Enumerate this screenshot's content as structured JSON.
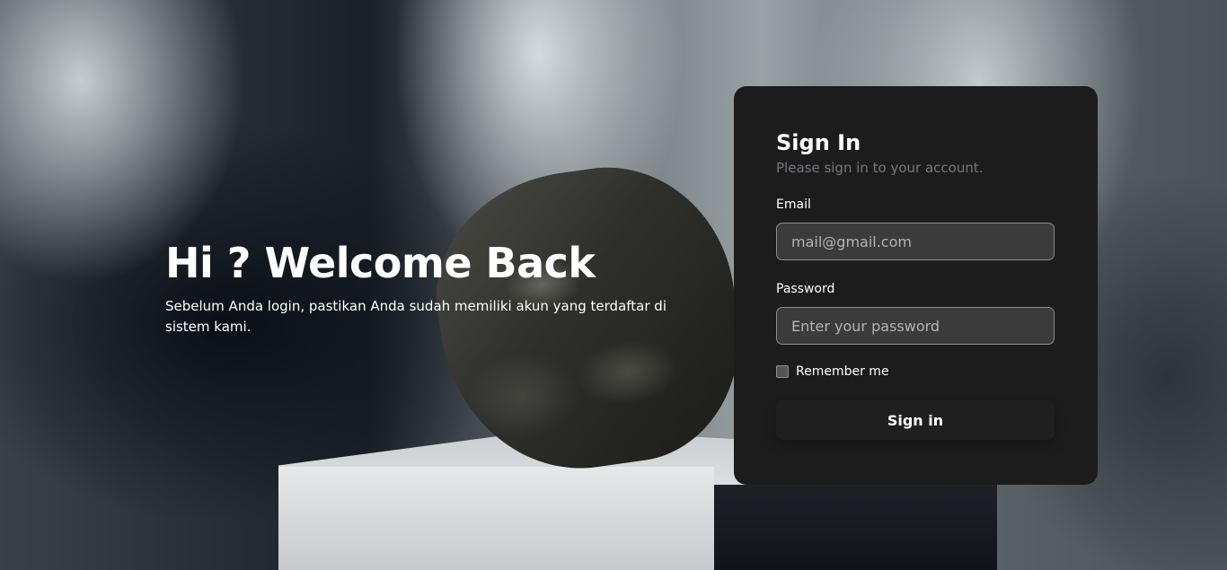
{
  "welcome": {
    "title": "Hi ? Welcome Back",
    "description": "Sebelum Anda login, pastikan Anda sudah memiliki akun yang terdaftar di sistem kami."
  },
  "signin": {
    "title": "Sign In",
    "subtitle": "Please sign in to your account.",
    "email_label": "Email",
    "email_placeholder": "mail@gmail.com",
    "email_value": "",
    "password_label": "Password",
    "password_placeholder": "Enter your password",
    "password_value": "",
    "remember_label": "Remember me",
    "remember_checked": false,
    "button_label": "Sign in"
  },
  "colors": {
    "card_background": "#1c1c1c",
    "input_background": "#3b3b3b",
    "subtitle_text": "#77777d"
  }
}
